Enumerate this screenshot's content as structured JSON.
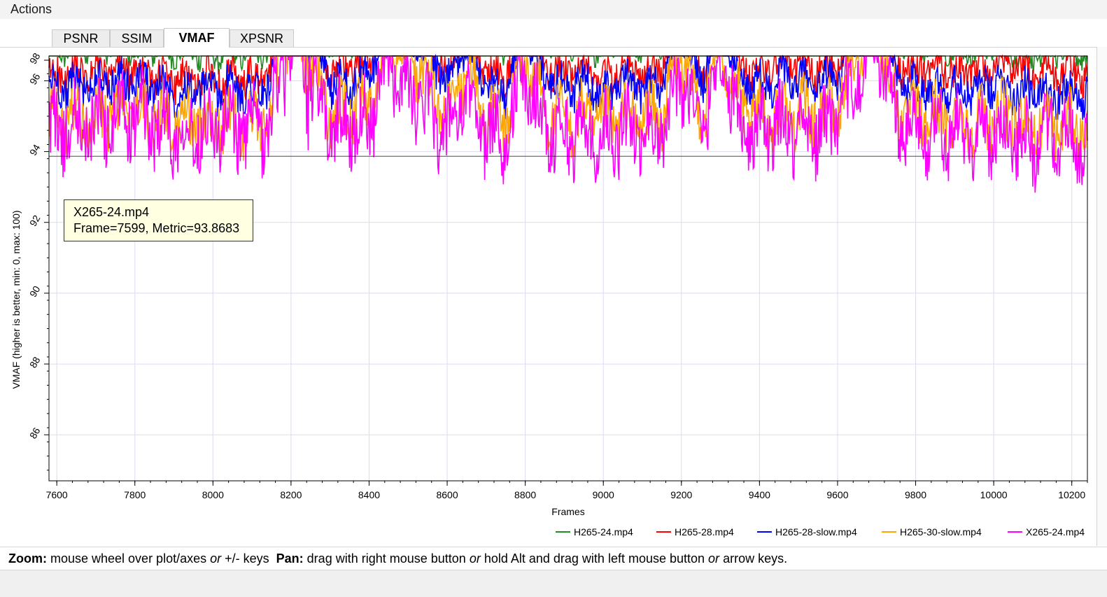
{
  "menu": {
    "actions_label": "Actions"
  },
  "tabs": [
    {
      "label": "PSNR",
      "active": false
    },
    {
      "label": "SSIM",
      "active": false
    },
    {
      "label": "VMAF",
      "active": true
    },
    {
      "label": "XPSNR",
      "active": false
    }
  ],
  "tooltip": {
    "title": "X265-24.mp4",
    "line": "Frame=7599, Metric=93.8683"
  },
  "status": {
    "zoom_label": "Zoom:",
    "zoom_text1": " mouse wheel over plot/axes ",
    "zoom_or": "or",
    "zoom_text2": " +/- keys  ",
    "pan_label": "Pan:",
    "pan_text1": " drag with right mouse button ",
    "pan_or1": "or",
    "pan_text2": " hold Alt and drag with left mouse button ",
    "pan_or2": "or",
    "pan_text3": " arrow keys."
  },
  "chart_data": {
    "type": "line",
    "xlabel": "Frames",
    "ylabel": "VMAF (higher is better, min: 0, max: 100)",
    "xlim": [
      7580,
      10240
    ],
    "ylim": [
      84.7,
      96.7
    ],
    "grid": true,
    "legend_position": "bottom-right",
    "x_ticks": [
      7600,
      7800,
      8000,
      8200,
      8400,
      8600,
      8800,
      9000,
      9200,
      9400,
      9600,
      9800,
      10000,
      10200
    ],
    "y_ticks": [
      86,
      88,
      90,
      92,
      94,
      96
    ],
    "y_tick_labels": [
      "86",
      "88",
      "90",
      "92",
      "94",
      "96",
      "98"
    ],
    "tracker_y": 93.8683,
    "series": [
      {
        "name": "H265-24.mp4",
        "color": "#228b22",
        "x": [
          7580,
          7700,
          7800,
          7900,
          8000,
          8100,
          8150,
          8170,
          8200,
          8250,
          8300,
          8350,
          8400,
          8450,
          8500,
          8550,
          8600,
          8650,
          8700,
          8750,
          8800,
          8850,
          8900,
          8950,
          9000,
          9050,
          9100,
          9150,
          9200,
          9250,
          9300,
          9350,
          9400,
          9450,
          9500,
          9550,
          9600,
          9650,
          9700,
          9750,
          9800,
          9850,
          9900,
          9950,
          10000,
          10050,
          10100,
          10150,
          10200,
          10240
        ],
        "y": [
          96.9,
          97.1,
          97.0,
          96.9,
          96.8,
          96.9,
          97.0,
          99.0,
          99.4,
          98.8,
          97.2,
          97.3,
          97.4,
          99.1,
          98.9,
          98.4,
          97.0,
          98.8,
          97.3,
          97.0,
          98.9,
          97.3,
          97.2,
          97.1,
          97.0,
          97.2,
          97.1,
          97.3,
          98.9,
          97.2,
          99.0,
          97.4,
          97.1,
          97.3,
          97.3,
          97.2,
          97.5,
          98.6,
          98.9,
          97.4,
          97.0,
          97.1,
          97.0,
          96.9,
          97.1,
          97.0,
          96.8,
          97.0,
          96.9,
          96.8
        ]
      },
      {
        "name": "H265-28.mp4",
        "color": "#ff0000",
        "x": [
          7580,
          7700,
          7800,
          7900,
          8000,
          8100,
          8150,
          8170,
          8200,
          8250,
          8300,
          8350,
          8400,
          8450,
          8500,
          8550,
          8600,
          8650,
          8700,
          8750,
          8800,
          8850,
          8900,
          8950,
          9000,
          9050,
          9100,
          9150,
          9200,
          9250,
          9300,
          9350,
          9400,
          9450,
          9500,
          9550,
          9600,
          9650,
          9700,
          9750,
          9800,
          9850,
          9900,
          9950,
          10000,
          10050,
          10100,
          10150,
          10200,
          10240
        ],
        "y": [
          96.1,
          96.2,
          96.3,
          96.0,
          96.1,
          96.0,
          96.2,
          98.6,
          98.8,
          98.0,
          96.3,
          96.4,
          96.5,
          98.3,
          97.9,
          97.3,
          96.2,
          97.5,
          96.3,
          96.1,
          97.8,
          96.4,
          96.2,
          96.3,
          96.1,
          96.3,
          96.2,
          96.4,
          97.8,
          96.3,
          98.2,
          96.5,
          96.2,
          96.4,
          96.4,
          96.3,
          96.5,
          97.8,
          98.6,
          96.5,
          96.3,
          96.4,
          96.3,
          96.2,
          96.5,
          96.4,
          96.2,
          96.3,
          96.2,
          96.1
        ]
      },
      {
        "name": "H265-28-slow.mp4",
        "color": "#0000ff",
        "x": [
          7580,
          7700,
          7800,
          7900,
          8000,
          8100,
          8150,
          8170,
          8200,
          8250,
          8300,
          8350,
          8400,
          8450,
          8500,
          8550,
          8600,
          8650,
          8700,
          8750,
          8800,
          8850,
          8900,
          8950,
          9000,
          9050,
          9100,
          9150,
          9200,
          9250,
          9300,
          9350,
          9400,
          9450,
          9500,
          9550,
          9600,
          9650,
          9700,
          9750,
          9800,
          9850,
          9900,
          9950,
          10000,
          10050,
          10100,
          10150,
          10200,
          10240
        ],
        "y": [
          95.8,
          95.9,
          96.0,
          95.7,
          95.8,
          95.7,
          95.9,
          98.2,
          98.5,
          97.6,
          95.9,
          96.0,
          96.1,
          98.0,
          97.5,
          96.9,
          95.8,
          97.1,
          95.9,
          95.7,
          97.4,
          96.0,
          95.8,
          95.9,
          95.7,
          95.9,
          95.8,
          96.0,
          97.4,
          95.9,
          97.8,
          96.1,
          95.8,
          96.0,
          96.0,
          95.9,
          96.1,
          97.4,
          98.3,
          96.1,
          95.8,
          95.9,
          95.8,
          95.7,
          95.9,
          95.8,
          95.6,
          95.7,
          95.6,
          95.5
        ]
      },
      {
        "name": "H265-30-slow.mp4",
        "color": "#ffa500",
        "x": [
          7580,
          7700,
          7800,
          7900,
          8000,
          8100,
          8150,
          8170,
          8200,
          8250,
          8300,
          8350,
          8400,
          8450,
          8500,
          8550,
          8600,
          8650,
          8700,
          8750,
          8800,
          8850,
          8900,
          8950,
          9000,
          9050,
          9100,
          9150,
          9200,
          9250,
          9300,
          9350,
          9400,
          9450,
          9500,
          9550,
          9600,
          9650,
          9700,
          9750,
          9800,
          9850,
          9900,
          9950,
          10000,
          10050,
          10100,
          10150,
          10200,
          10240
        ],
        "y": [
          94.8,
          95.0,
          95.1,
          94.8,
          94.9,
          94.8,
          95.0,
          97.6,
          98.0,
          96.8,
          95.0,
          95.1,
          95.2,
          97.4,
          96.8,
          96.0,
          94.9,
          96.4,
          95.0,
          94.8,
          96.8,
          95.1,
          94.9,
          95.0,
          94.8,
          95.0,
          94.9,
          95.1,
          96.8,
          95.0,
          97.2,
          95.2,
          94.9,
          95.1,
          95.1,
          95.0,
          95.2,
          96.8,
          97.8,
          95.2,
          94.9,
          95.0,
          94.9,
          94.8,
          95.0,
          94.9,
          94.7,
          94.8,
          94.7,
          94.6
        ]
      },
      {
        "name": "X265-24.mp4",
        "color": "#ff00ff",
        "x": [
          7580,
          7700,
          7800,
          7900,
          8000,
          8100,
          8150,
          8170,
          8200,
          8250,
          8300,
          8350,
          8400,
          8450,
          8500,
          8550,
          8600,
          8650,
          8700,
          8750,
          8800,
          8850,
          8900,
          8950,
          9000,
          9050,
          9100,
          9150,
          9200,
          9250,
          9300,
          9350,
          9400,
          9450,
          9500,
          9550,
          9600,
          9650,
          9700,
          9750,
          9800,
          9850,
          9900,
          9950,
          10000,
          10050,
          10100,
          10150,
          10200,
          10240
        ],
        "y": [
          94.6,
          94.8,
          95.0,
          94.6,
          94.7,
          94.6,
          94.8,
          97.0,
          97.6,
          96.0,
          94.7,
          94.8,
          94.9,
          96.6,
          95.8,
          95.2,
          94.5,
          95.6,
          94.6,
          94.4,
          96.2,
          94.7,
          94.5,
          94.6,
          94.4,
          94.6,
          94.5,
          94.7,
          96.2,
          94.6,
          96.6,
          94.8,
          94.5,
          94.7,
          94.7,
          94.6,
          94.8,
          96.0,
          97.2,
          94.8,
          94.5,
          94.6,
          94.5,
          94.4,
          94.6,
          94.5,
          94.3,
          94.4,
          94.3,
          94.2
        ]
      }
    ]
  }
}
